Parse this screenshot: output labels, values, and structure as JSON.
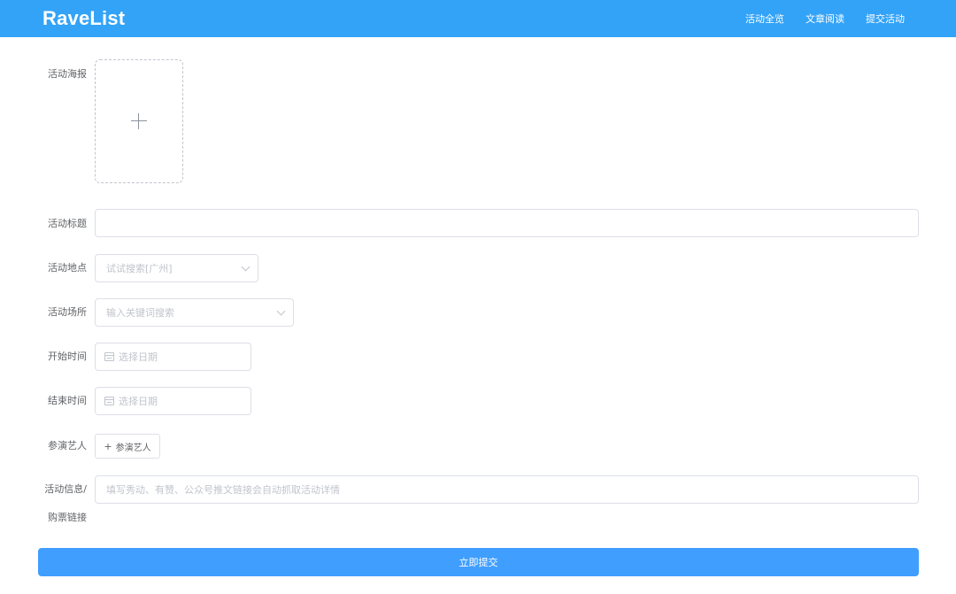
{
  "app": {
    "brand": "RaveList"
  },
  "nav": {
    "items": [
      {
        "label": "活动全览"
      },
      {
        "label": "文章阅读"
      },
      {
        "label": "提交活动"
      }
    ]
  },
  "form": {
    "poster": {
      "label": "活动海报"
    },
    "title": {
      "label": "活动标题",
      "value": ""
    },
    "location": {
      "label": "活动地点",
      "placeholder": "试试搜索[广州]"
    },
    "venue": {
      "label": "活动场所",
      "placeholder": "输入关键词搜索"
    },
    "start_time": {
      "label": "开始时间",
      "placeholder": "选择日期"
    },
    "end_time": {
      "label": "结束时间",
      "placeholder": "选择日期"
    },
    "artists": {
      "label": "参演艺人",
      "button_label": "参演艺人",
      "button_icon": "+"
    },
    "info": {
      "label_line1": "活动信息/",
      "label_line2": "购票链接",
      "placeholder": "填写秀动、有赞、公众号推文链接会自动抓取活动详情"
    },
    "submit_label": "立即提交"
  },
  "colors": {
    "navbar": "#33a3f7",
    "primary": "#409eff",
    "border": "#dcdfe6",
    "placeholder": "#c0c4cc",
    "label": "#606266"
  }
}
